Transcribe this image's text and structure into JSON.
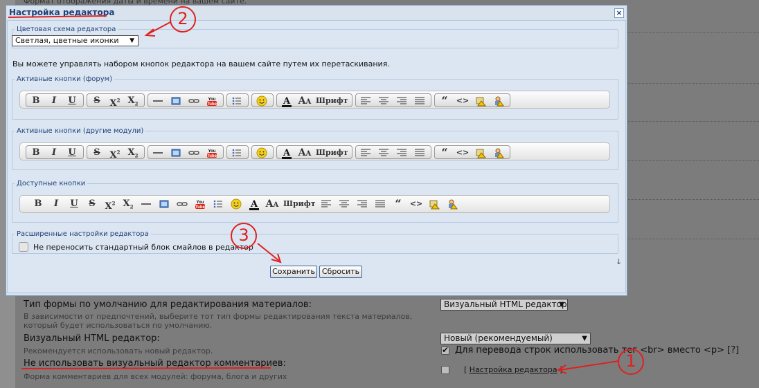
{
  "background": {
    "top_text": "Формат отображения даты и времени на вашем сайте.",
    "form_type_label": "Тип формы по умолчанию для редактирования материалов:",
    "form_type_hint": "В зависимости от предпочтений, выберите тот тип формы редактирования текста материалов, который будет использоваться по умолчанию.",
    "form_type_value": "Визуальный HTML редактор",
    "visual_editor_label": "Визуальный HTML редактор:",
    "visual_editor_hint": "Рекомендуется использовать новый редактор.",
    "visual_editor_value": "Новый (рекомендуемый)",
    "br_label": "Для перевода строк использовать тег <br> вместо <p>",
    "br_help": "[?]",
    "no_visual_comments_label": "Не использовать визуальный редактор комментариев:",
    "no_visual_comments_hint": "Форма комментариев для всех модулей: форума, блога и других",
    "editor_settings_link_open": "[",
    "editor_settings_link": "Настройка редактора",
    "editor_settings_link_close": "]"
  },
  "dialog": {
    "title": "Настройка редактора",
    "close": "×",
    "color_scheme_legend": "Цветовая схема редактора",
    "color_scheme_value": "Светлая, цветные иконки",
    "manage_text": "Вы можете управлять набором кнопок редактора на вашем сайте путем их перетаскивания.",
    "active_forum_legend": "Активные кнопки (форум)",
    "active_other_legend": "Активные кнопки (другие модули)",
    "available_legend": "Доступные кнопки",
    "advanced_legend": "Расширенные настройки редактора",
    "no_smiles_label": "Не переносить стандартный блок смайлов в редактор",
    "save_button": "Сохранить",
    "reset_button": "Сбросить",
    "scroll_arrow": "↓",
    "font_label": "Шрифт"
  },
  "annotations": {
    "marker_1": "1",
    "marker_2": "2",
    "marker_3": "3"
  },
  "colors": {
    "accent_red": "#e02020",
    "dialog_bg": "#dbe6f2",
    "title_blue": "#1f3f78"
  }
}
